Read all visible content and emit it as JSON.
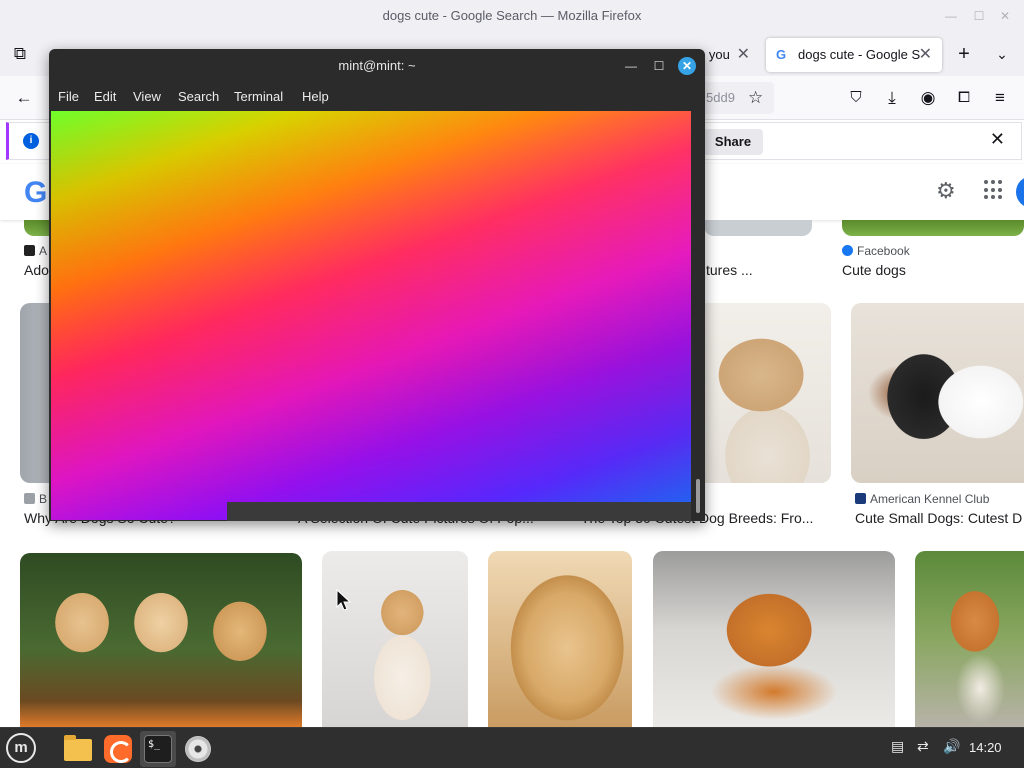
{
  "firefox": {
    "window_title": "dogs cute - Google Search — Mozilla Firefox",
    "tabs": [
      {
        "label": "o you",
        "active": false
      },
      {
        "label": "dogs cute - Google S",
        "active": true
      }
    ],
    "url_fragment": "5dd9",
    "infobar": {
      "share_label": "Share"
    }
  },
  "google": {
    "logo_letter": "G",
    "results_row1": [
      {
        "source": "A",
        "title": "Ado"
      },
      {
        "source": "",
        "title": "tures ..."
      },
      {
        "source": "Facebook",
        "title": "Cute dogs"
      }
    ],
    "results_row2": [
      {
        "source": "B",
        "title": "Why Are Dogs So Cute?"
      },
      {
        "source": "",
        "title": "A Selection Of Cute Pictures Of Pop..."
      },
      {
        "source": "",
        "title": "The Top 30 Cutest Dog Breeds: Fro..."
      },
      {
        "source": "American Kennel Club",
        "title": "Cute Small Dogs: Cutest D"
      }
    ]
  },
  "terminal": {
    "title": "mint@mint: ~",
    "menu": [
      "File",
      "Edit",
      "View",
      "Search",
      "Terminal",
      "Help"
    ]
  },
  "taskbar": {
    "clock": "14:20",
    "menu_logo": "m",
    "terminal_icon_text": "$_"
  },
  "colors": {
    "accent_blue": "#35a3e6",
    "google_blue": "#4285f4",
    "firefox_purple": "#a238ff"
  }
}
